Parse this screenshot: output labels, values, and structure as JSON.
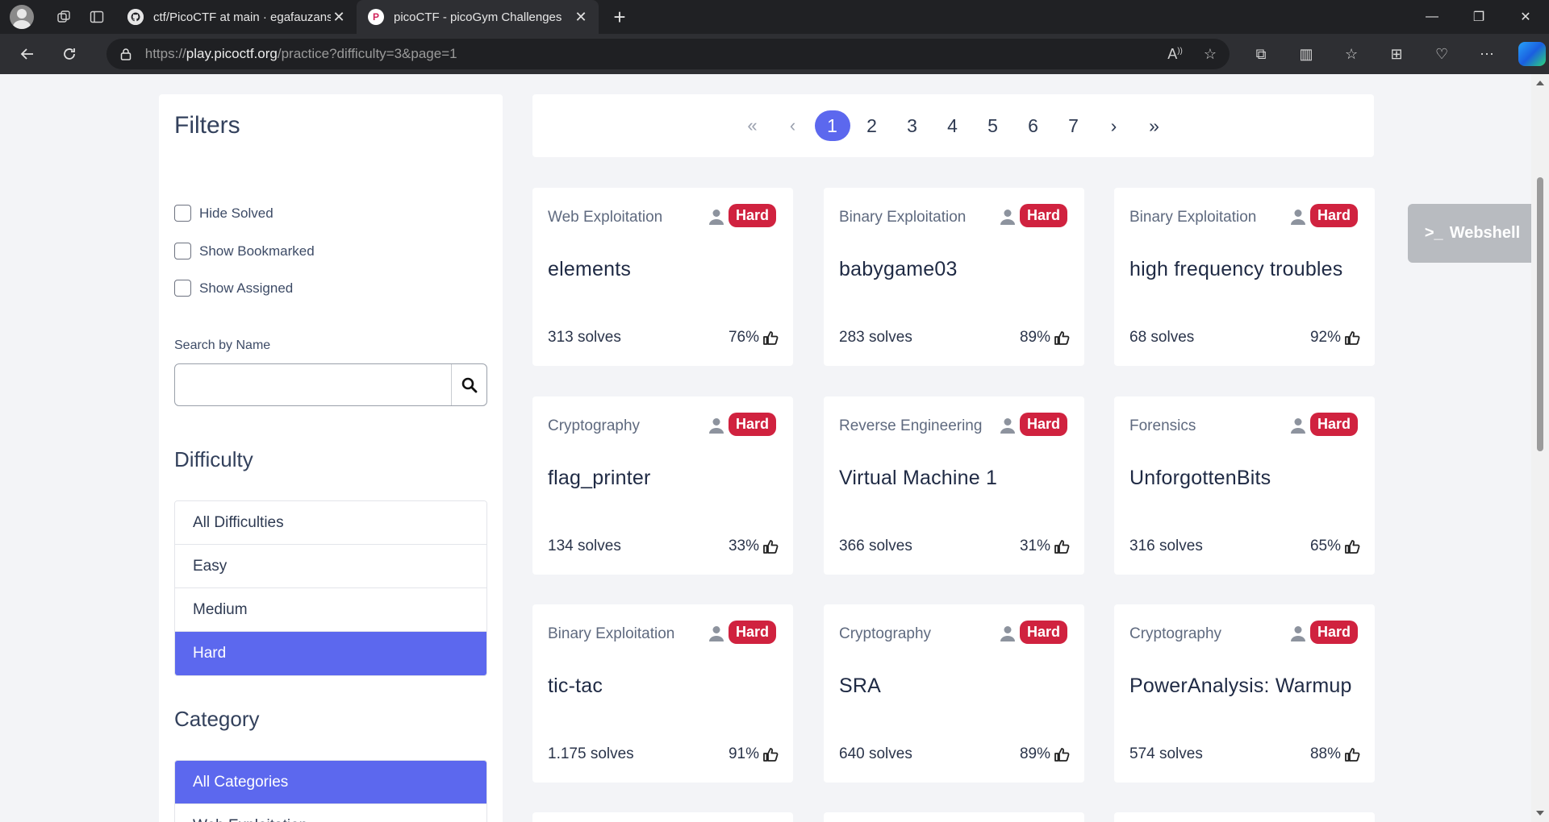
{
  "browser": {
    "tabs": [
      {
        "title": "ctf/PicoCTF at main · egafauzans/",
        "active": false
      },
      {
        "title": "picoCTF - picoGym Challenges",
        "active": true
      }
    ],
    "url_prefix": "https://",
    "url_host": "play.picoctf.org",
    "url_path": "/practice?difficulty=3&page=1"
  },
  "filters": {
    "title": "Filters",
    "checkboxes": [
      "Hide Solved",
      "Show Bookmarked",
      "Show Assigned"
    ],
    "search_label": "Search by Name",
    "search_value": "",
    "difficulty_heading": "Difficulty",
    "difficulties": [
      "All Difficulties",
      "Easy",
      "Medium",
      "Hard"
    ],
    "selected_difficulty": "Hard",
    "category_heading": "Category",
    "categories": [
      "All Categories",
      "Web Exploitation"
    ],
    "selected_category": "All Categories"
  },
  "pagination": {
    "first": "«",
    "prev": "‹",
    "pages": [
      "1",
      "2",
      "3",
      "4",
      "5",
      "6",
      "7"
    ],
    "current": "1",
    "next": "›",
    "last": "»"
  },
  "challenges": [
    {
      "category": "Web Exploitation",
      "difficulty": "Hard",
      "name": "elements",
      "solves": "313 solves",
      "rating": "76%"
    },
    {
      "category": "Binary Exploitation",
      "difficulty": "Hard",
      "name": "babygame03",
      "solves": "283 solves",
      "rating": "89%"
    },
    {
      "category": "Binary Exploitation",
      "difficulty": "Hard",
      "name": "high frequency troubles",
      "solves": "68 solves",
      "rating": "92%"
    },
    {
      "category": "Cryptography",
      "difficulty": "Hard",
      "name": "flag_printer",
      "solves": "134 solves",
      "rating": "33%"
    },
    {
      "category": "Reverse Engineering",
      "difficulty": "Hard",
      "name": "Virtual Machine 1",
      "solves": "366 solves",
      "rating": "31%"
    },
    {
      "category": "Forensics",
      "difficulty": "Hard",
      "name": "UnforgottenBits",
      "solves": "316 solves",
      "rating": "65%"
    },
    {
      "category": "Binary Exploitation",
      "difficulty": "Hard",
      "name": "tic-tac",
      "solves": "1.175 solves",
      "rating": "91%"
    },
    {
      "category": "Cryptography",
      "difficulty": "Hard",
      "name": "SRA",
      "solves": "640 solves",
      "rating": "89%"
    },
    {
      "category": "Cryptography",
      "difficulty": "Hard",
      "name": "PowerAnalysis: Warmup",
      "solves": "574 solves",
      "rating": "88%"
    }
  ],
  "webshell": {
    "label": "Webshell"
  },
  "colors": {
    "accent": "#5c68ee",
    "hard_badge": "#d0223f"
  }
}
